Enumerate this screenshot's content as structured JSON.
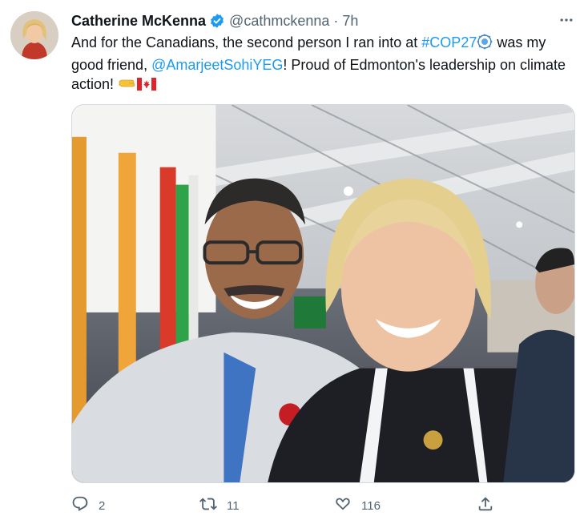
{
  "tweet": {
    "display_name": "Catherine McKenna",
    "handle": "@cathmckenna",
    "separator": "·",
    "time": "7h",
    "verified": true,
    "text": {
      "part1": "And for the Canadians, the second person I ran into at ",
      "hashtag": "#COP27",
      "part2": " was my good friend, ",
      "mention": "@AmarjeetSohiYEG",
      "part3": "! Proud of Edmonton's leadership on climate action! "
    },
    "emoji_after_hashtag": "cop-globe-emoji",
    "emoji_end": [
      "clap-hand-emoji",
      "canada-flag-emoji"
    ]
  },
  "actions": {
    "reply_count": "2",
    "retweet_count": "11",
    "like_count": "116"
  },
  "colors": {
    "link": "#1d9bf0",
    "secondary_text": "#536471",
    "verified_badge": "#1d9bf0"
  },
  "icons": [
    "more-icon",
    "verified-icon",
    "reply-icon",
    "retweet-icon",
    "like-icon",
    "share-icon"
  ]
}
